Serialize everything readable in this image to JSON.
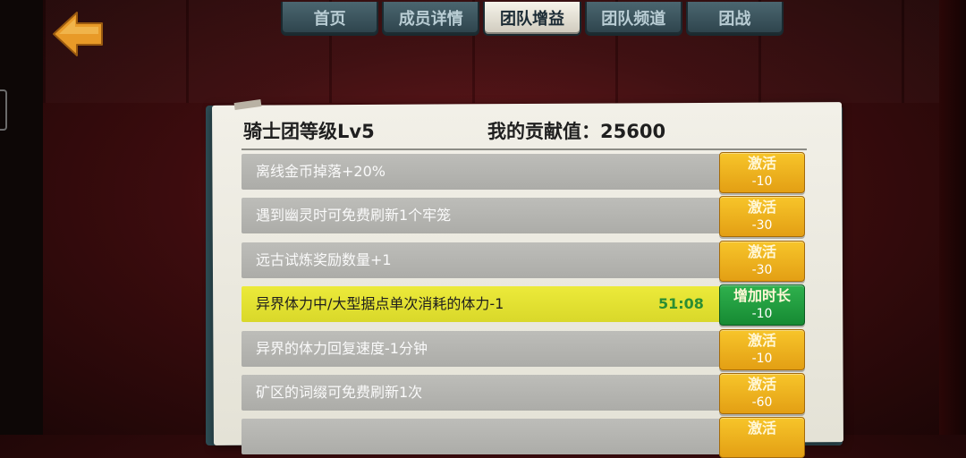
{
  "nav": {
    "tabs": [
      {
        "label": "首页",
        "active": false
      },
      {
        "label": "成员详情",
        "active": false
      },
      {
        "label": "团队增益",
        "active": true
      },
      {
        "label": "团队频道",
        "active": false
      },
      {
        "label": "团战",
        "active": false
      }
    ]
  },
  "panel": {
    "level_text": "骑士团等级Lv5",
    "contribution_text": "我的贡献值：25600"
  },
  "buffs": [
    {
      "label": "离线金币掉落+20%",
      "button_label": "激活",
      "cost": "-10"
    },
    {
      "label": "遇到幽灵时可免费刷新1个牢笼",
      "button_label": "激活",
      "cost": "-30"
    },
    {
      "label": "远古试炼奖励数量+1",
      "button_label": "激活",
      "cost": "-30"
    },
    {
      "label": "异界体力中/大型据点单次消耗的体力-1",
      "timer": "51:08",
      "button_label": "增加时长",
      "cost": "-10",
      "active": true
    },
    {
      "label": "异界的体力回复速度-1分钟",
      "button_label": "激活",
      "cost": "-10"
    },
    {
      "label": "矿区的词缀可免费刷新1次",
      "button_label": "激活",
      "cost": "-60"
    },
    {
      "label": "",
      "button_label": "激活",
      "cost": ""
    }
  ],
  "colors": {
    "highlight_row": "#e4e232",
    "activate_button": "#f0b020",
    "extend_button": "#22a040",
    "timer_text": "#2c8e33",
    "active_tab": "#ecebe2"
  }
}
